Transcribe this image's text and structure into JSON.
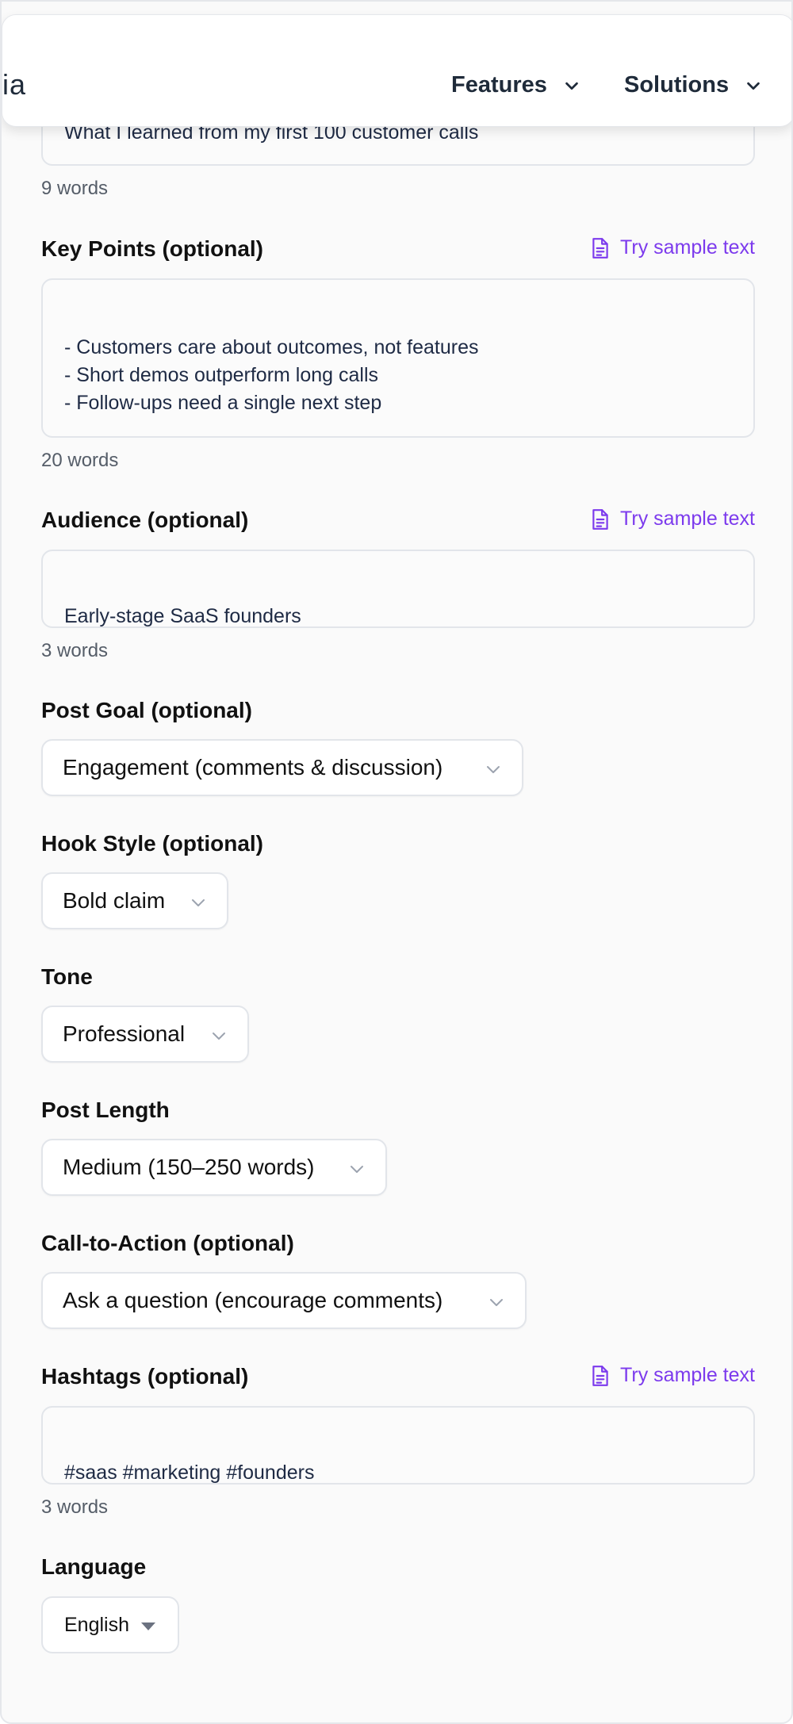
{
  "nav": {
    "logo_fragment": "ia",
    "features_label": "Features",
    "solutions_label": "Solutions"
  },
  "form": {
    "title_field": {
      "value": "What I learned from my first 100 customer calls",
      "word_count": "9 words"
    },
    "key_points": {
      "label": "Key Points (optional)",
      "sample_label": "Try sample text",
      "value": "- Customers care about outcomes, not features\n- Short demos outperform long calls\n- Follow-ups need a single next step",
      "word_count": "20 words"
    },
    "audience": {
      "label": "Audience (optional)",
      "sample_label": "Try sample text",
      "value": "Early-stage SaaS founders",
      "word_count": "3 words"
    },
    "post_goal": {
      "label": "Post Goal (optional)",
      "selected": "Engagement (comments & discussion)"
    },
    "hook_style": {
      "label": "Hook Style (optional)",
      "selected": "Bold claim"
    },
    "tone": {
      "label": "Tone",
      "selected": "Professional"
    },
    "post_length": {
      "label": "Post Length",
      "selected": "Medium (150–250 words)"
    },
    "cta": {
      "label": "Call-to-Action (optional)",
      "selected": "Ask a question (encourage comments)"
    },
    "hashtags": {
      "label": "Hashtags (optional)",
      "sample_label": "Try sample text",
      "value": "#saas #marketing #founders",
      "word_count": "3 words"
    },
    "language": {
      "label": "Language",
      "selected": "English"
    }
  },
  "colors": {
    "accent": "#7c3aed",
    "nav_text": "#1f2b3a",
    "field_border": "#e2e5ea",
    "page_background": "#fafafa"
  },
  "icons": {
    "sample": "document-text-icon",
    "dropdown": "chevron-down-icon",
    "language_dropdown": "caret-down-icon"
  }
}
